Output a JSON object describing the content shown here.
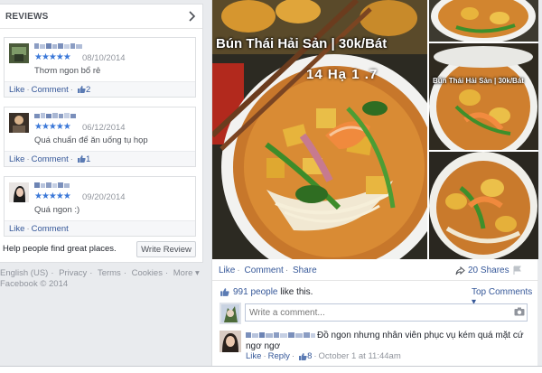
{
  "reviews": {
    "title": "REVIEWS",
    "items": [
      {
        "stars": "★★★★★",
        "date": "08/10/2014",
        "text": "Thơm ngon bổ rẻ",
        "like": "Like",
        "comment": "Comment",
        "likes": "2"
      },
      {
        "stars": "★★★★★",
        "date": "06/12/2014",
        "text": "Quá chuẩn để ăn uống tụ họp",
        "like": "Like",
        "comment": "Comment",
        "likes": "1"
      },
      {
        "stars": "★★★★★",
        "date": "09/20/2014",
        "text": "Quá ngon :)",
        "like": "Like",
        "comment": "Comment"
      }
    ],
    "help_text": "Help people find great places.",
    "write_review": "Write Review"
  },
  "footer": {
    "line1": [
      "English (US)",
      "·",
      "Privacy",
      "·",
      "Terms",
      "·",
      "Cookies",
      "·",
      "More ▾"
    ],
    "line2": "Facebook © 2014"
  },
  "post": {
    "overlay_title": "Bún Thái Hải Sản | 30k/Bát",
    "overlay_price": "14 Hạ 1 .7",
    "actions": {
      "like": "Like",
      "comment": "Comment",
      "share": "Share"
    },
    "shares": "20 Shares",
    "likes_count": "991 people",
    "likes_suffix": "like this.",
    "top_comments": "Top Comments ▾",
    "comment_placeholder": "Write a comment...",
    "comment": {
      "text": "Đồ ngon nhưng nhân viên phục vụ kém quá mặt cứ ngơ ngơ",
      "like": "Like",
      "reply": "Reply",
      "likes": "8",
      "time": "October 1 at 11:44am"
    }
  },
  "colors": {
    "link": "#365899",
    "star": "#3b78d8",
    "page_bg": "#e9ebee"
  },
  "icons": [
    "chevron-right-icon",
    "thumbs-up-icon",
    "share-icon",
    "flag-icon",
    "camera-icon"
  ]
}
